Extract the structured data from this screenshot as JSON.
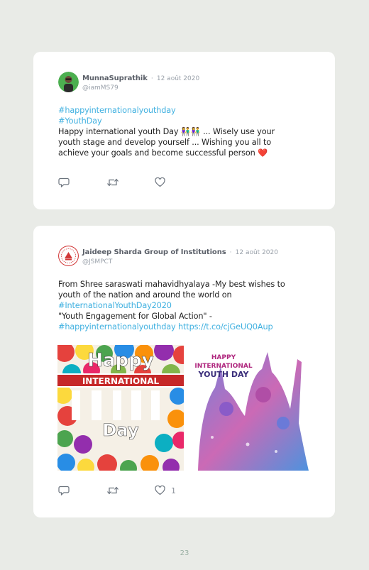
{
  "tweets": [
    {
      "author": "MunnaSuprathik",
      "separator": "·",
      "date": "12 août 2020",
      "handle": "@iamMS79",
      "lines": [
        {
          "text": "#happyinternationalyouthday",
          "link": true
        },
        {
          "text": "#YouthDay",
          "link": true
        },
        {
          "text": "Happy international youth Day 👫👫 ... Wisely use your",
          "link": false
        },
        {
          "text": "youth stage and develop yourself ... Wishing you all to",
          "link": false
        },
        {
          "text": "achieve your goals and become successful person ❤️",
          "link": false
        }
      ],
      "likes": ""
    },
    {
      "author": "Jaideep Sharda Group of Institutions",
      "separator": "·",
      "date": "12 août 2020",
      "handle": "@JSMPCT",
      "lines": [
        {
          "text": "From Shree saraswati mahavidhyalaya -My best wishes to",
          "link": false
        },
        {
          "text": "youth of the nation and around the world on",
          "link": false
        },
        {
          "text": "#InternationalYouthDay2020",
          "link": true
        },
        {
          "text": "\"Youth Engagement for Global Action\" -",
          "link": false
        }
      ],
      "last_line_tag": "#happyinternationalyouthday",
      "last_line_url": "https://t.co/cjGeUQ0Aup",
      "likes": "1",
      "image_left": {
        "line1": "Happy",
        "line2": "INTERNATIONAL",
        "line3": "Day"
      },
      "image_right": {
        "line1": "HAPPY",
        "line2": "INTERNATIONAL",
        "line3": "YOUTH DAY"
      }
    }
  ],
  "page_number": "23",
  "colors": {
    "link": "#3fb0e0",
    "heart": "#e0245e",
    "background": "#e9ebe7"
  },
  "icons": {
    "reply": "reply-icon",
    "retweet": "retweet-icon",
    "like": "heart-icon"
  }
}
